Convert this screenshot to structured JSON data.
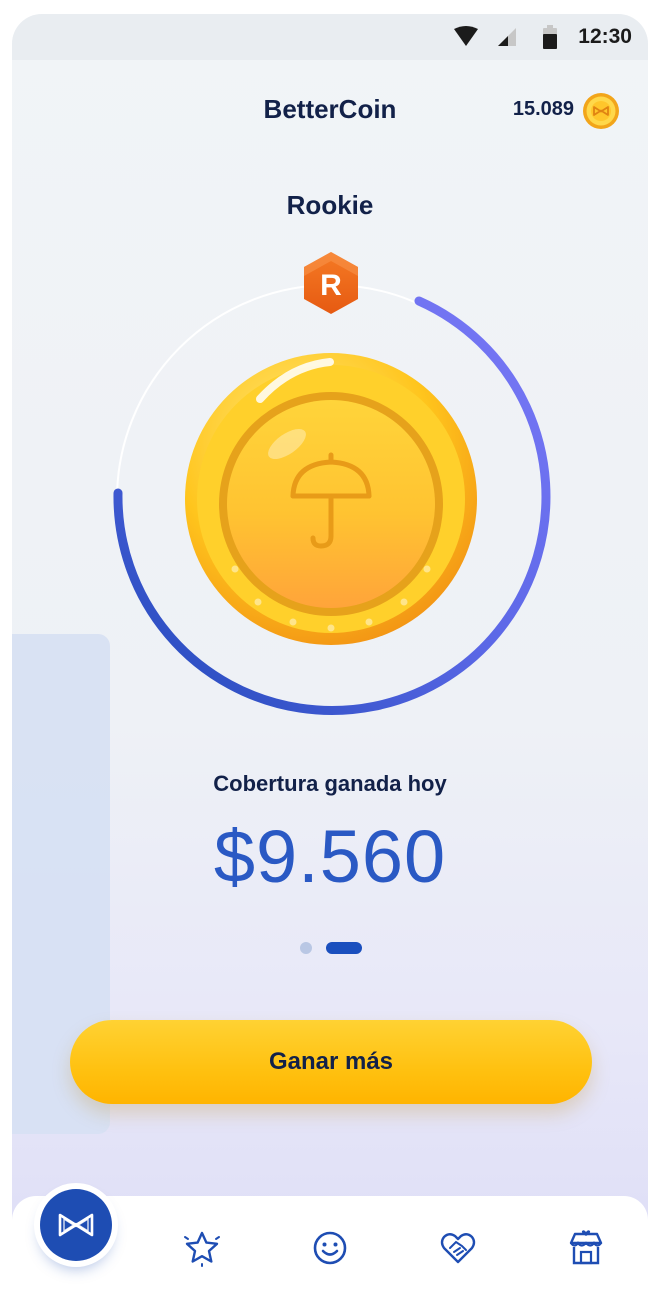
{
  "status_bar": {
    "time": "12:30",
    "icons": [
      "wifi-icon",
      "signal-icon",
      "battery-icon"
    ]
  },
  "header": {
    "title": "BetterCoin",
    "balance": "15.089",
    "balance_icon": "coin-icon"
  },
  "level": {
    "name": "Rookie",
    "badge_letter": "R",
    "progress": 0.62
  },
  "coverage": {
    "label": "Cobertura ganada hoy",
    "amount": "$9.560"
  },
  "carousel": {
    "pages": 2,
    "active_index": 1
  },
  "cta": {
    "label": "Ganar más"
  },
  "nav": {
    "items": [
      {
        "icon": "home-logo-icon",
        "active": true
      },
      {
        "icon": "star-icon"
      },
      {
        "icon": "smiley-icon"
      },
      {
        "icon": "handshake-heart-icon"
      },
      {
        "icon": "store-icon"
      }
    ]
  },
  "colors": {
    "primary": "#1e4db3",
    "accent": "#ffc110",
    "text": "#122149",
    "badge": "#f06a1d"
  }
}
